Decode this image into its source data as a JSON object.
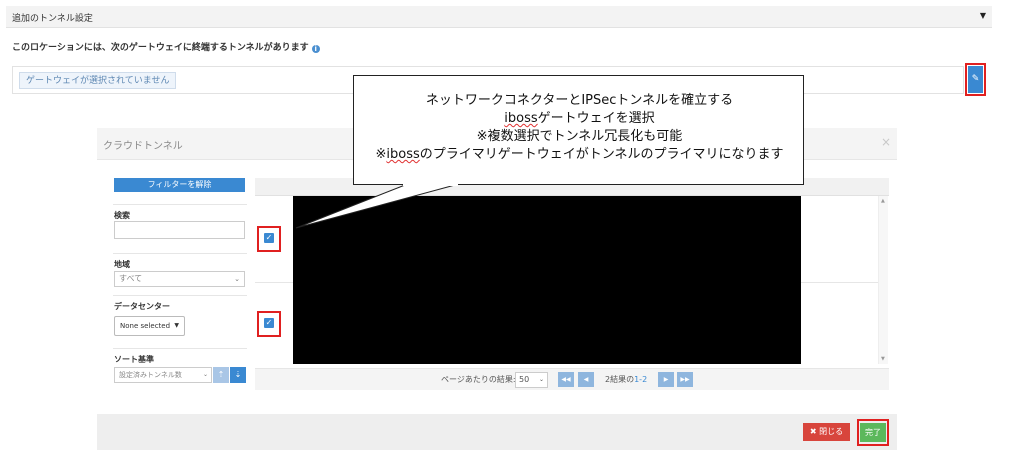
{
  "tunnel_section": {
    "header_title": "追加のトンネル設定",
    "info_text": "このロケーションには、次のゲートウェイに終端するトンネルがあります",
    "info_icon": "i",
    "gateway_tag": "ゲートウェイが選択されていません",
    "edit_icon": "pencil-icon"
  },
  "modal": {
    "title": "クラウドトンネル",
    "close_glyph": "×",
    "filters": {
      "clear_label": "フィルターを解除",
      "search_label": "検索",
      "search_value": "",
      "region_label": "地域",
      "region_value": "すべて",
      "datacenter_label": "データセンター",
      "datacenter_value": "None selected",
      "sort_label": "ソート基準",
      "sort_value": "設定済みトンネル数"
    },
    "pager": {
      "per_page_label": "ページあたりの結果:",
      "per_page_value": "50",
      "results_prefix": "2結果の",
      "results_range": "1-2"
    },
    "footer": {
      "close_label": "閉じる",
      "done_label": "完了"
    }
  },
  "callout": {
    "line1": "ネットワークコネクターとIPSecトンネルを確立する",
    "line2_brand": "iboss",
    "line2_rest": "ゲートウェイを選択",
    "line3": "※複数選択でトンネル冗長化も可能",
    "line4_prefix": "※",
    "line4_brand": "iboss",
    "line4_rest": "のプライマリゲートウェイがトンネルのプライマリになります"
  },
  "colors": {
    "accent": "#3a89d2",
    "highlight": "#e02020",
    "done": "#5cb85c",
    "close": "#d8453c"
  }
}
